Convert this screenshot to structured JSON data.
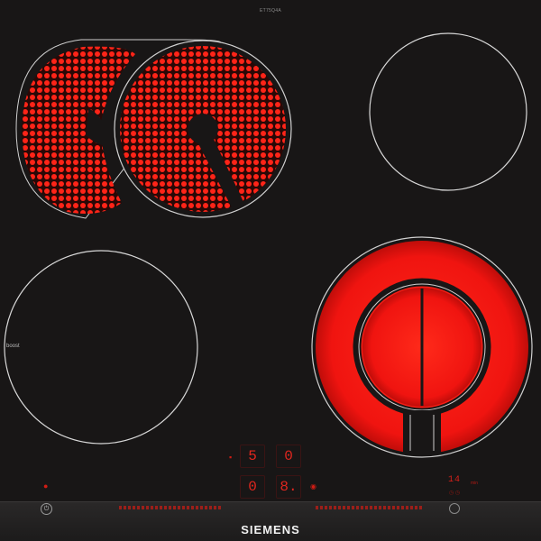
{
  "appliance": {
    "model_code": "ET75Q4A",
    "brand": "SIEMENS",
    "boost_label": "boost"
  },
  "zones": [
    {
      "id": "top-left",
      "type": "dual-oval",
      "state": "on"
    },
    {
      "id": "top-right",
      "type": "single",
      "state": "off"
    },
    {
      "id": "bottom-left",
      "type": "single",
      "state": "off",
      "label": "boost"
    },
    {
      "id": "bottom-right",
      "type": "dual-ring",
      "state": "on"
    }
  ],
  "displays": [
    {
      "id": "top-left-digit",
      "value": "5"
    },
    {
      "id": "top-right-digit",
      "value": "0"
    },
    {
      "id": "bottom-left-digit",
      "value": "0"
    },
    {
      "id": "bottom-right-digit",
      "value": "8."
    }
  ],
  "timer": {
    "value": "14",
    "unit": "min"
  },
  "colors": {
    "glass": "#181616",
    "heat": "#e4120c",
    "zone_outline": "#cfcfcf",
    "display": "#e0261e",
    "brand_text": "#f2f2f2"
  },
  "icons": {
    "power": "power-icon",
    "timer": "timer-icon",
    "indicator": "indicator-dot-icon"
  }
}
